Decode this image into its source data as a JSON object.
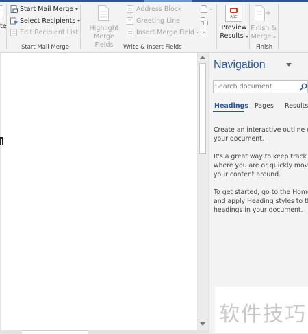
{
  "ribbon": {
    "group_left_fragment": "te",
    "start_mail_merge": {
      "start_label": "Start Mail Merge",
      "select_label": "Select Recipients",
      "edit_label": "Edit Recipient List",
      "group_label": "Start Mail Merge"
    },
    "write_insert": {
      "highlight_line1": "Highlight",
      "highlight_line2": "Merge Fields",
      "address_block": "Address Block",
      "greeting_line": "Greeting Line",
      "insert_merge_field": "Insert Merge Field",
      "group_label": "Write & Insert Fields"
    },
    "preview": {
      "line1": "Preview",
      "line2": "Results",
      "icon_text": "ABC"
    },
    "finish": {
      "line1": "Finish &",
      "line2": "Merge",
      "group_label": "Finish"
    }
  },
  "navigation": {
    "title": "Navigation",
    "search_placeholder": "Search document",
    "tabs": [
      "Headings",
      "Pages",
      "Results"
    ],
    "active_tab": "Headings",
    "para1_line1": "Create an interactive outline of",
    "para1_line2": "your document.",
    "para2_line1": "It's a great way to keep track of",
    "para2_line2": "where you are or quickly move",
    "para2_line3": "your content around.",
    "para3_line1": "To get started, go to the Home t",
    "para3_line2": "and apply Heading styles to the",
    "para3_line3": "headings in your document."
  },
  "watermark": "软件技巧",
  "colors": {
    "accent": "#2b579a",
    "ribbon_bg": "#f3f3f3",
    "disabled_text": "#a6a6a6"
  }
}
